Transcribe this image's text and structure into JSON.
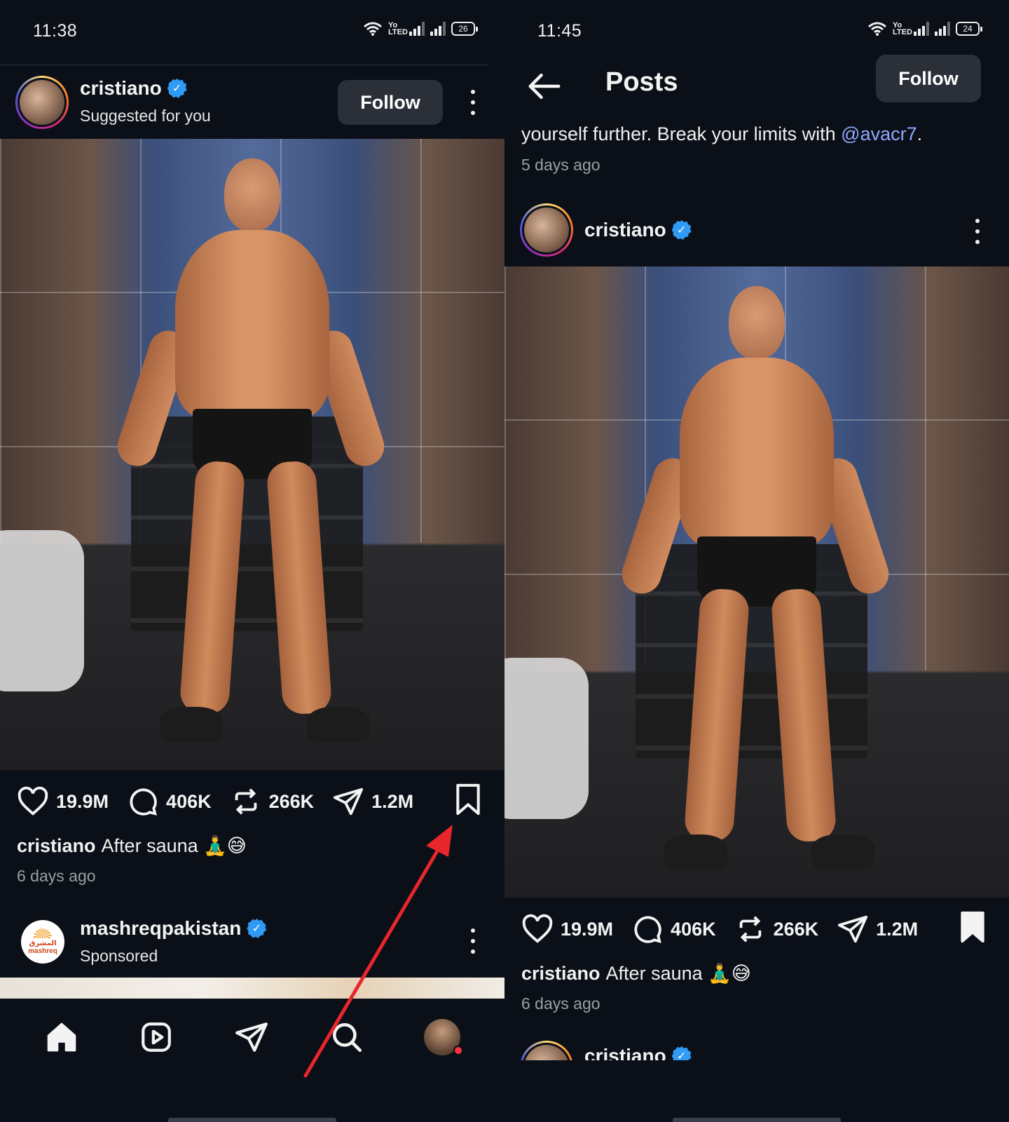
{
  "left": {
    "status": {
      "time": "11:38",
      "battery": "26",
      "volte": "Yo LTED"
    },
    "post": {
      "username": "cristiano",
      "subtitle": "Suggested for you",
      "follow_label": "Follow",
      "likes": "19.9M",
      "comments": "406K",
      "reposts": "266K",
      "shares": "1.2M",
      "caption_user": "cristiano",
      "caption_text": "After sauna 🧘‍♂️😅",
      "time_ago": "6 days ago"
    },
    "sponsored": {
      "username": "mashreqpakistan",
      "subtitle": "Sponsored",
      "logo_arabic": "المشرق",
      "logo_text": "mashreq"
    },
    "nav": [
      "home-icon",
      "reels-icon",
      "send-icon",
      "search-icon",
      "profile-avatar"
    ]
  },
  "right": {
    "status": {
      "time": "11:45",
      "battery": "24",
      "volte": "Yo LTED"
    },
    "header": {
      "title": "Posts",
      "follow_label": "Follow"
    },
    "prev_caption": {
      "text": "yourself further. Break your limits with ",
      "mention": "@avacr7",
      "suffix": ".",
      "time_ago": "5 days ago"
    },
    "post": {
      "username": "cristiano",
      "likes": "19.9M",
      "comments": "406K",
      "reposts": "266K",
      "shares": "1.2M",
      "caption_user": "cristiano",
      "caption_text": "After sauna 🧘‍♂️😅",
      "time_ago": "6 days ago"
    },
    "next_post": {
      "username": "cristiano"
    }
  },
  "colors": {
    "background": "#0b0f17",
    "verified": "#2f9bf5",
    "annotation_arrow": "#e8262c",
    "mention": "#8fa8ff",
    "button": "#2a2f38"
  }
}
